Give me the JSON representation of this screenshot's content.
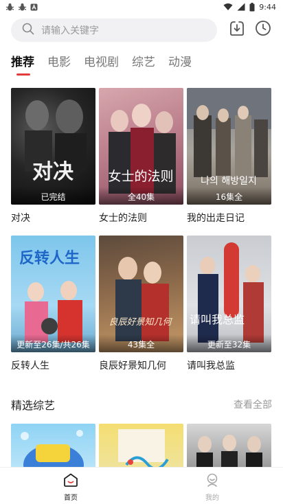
{
  "status_bar": {
    "time": "9:44",
    "left_icons": [
      "bug-icon",
      "bug-icon",
      "notification-a-icon"
    ],
    "right_icons": [
      "wifi-icon",
      "signal-icon",
      "battery-icon"
    ]
  },
  "search": {
    "placeholder": "请输入关键字"
  },
  "header_actions": {
    "download_icon": "download-icon",
    "history_icon": "clock-icon"
  },
  "tabs": [
    {
      "label": "推荐",
      "active": true
    },
    {
      "label": "电影",
      "active": false
    },
    {
      "label": "电视剧",
      "active": false
    },
    {
      "label": "综艺",
      "active": false
    },
    {
      "label": "动漫",
      "active": false
    }
  ],
  "shows_row1": [
    {
      "title": "对决",
      "badge": "已完结"
    },
    {
      "title": "女士的法则",
      "badge": "全40集"
    },
    {
      "title": "我的出走日记",
      "badge": "16集全"
    }
  ],
  "shows_row2": [
    {
      "title": "反转人生",
      "badge": "更新至26集/共26集"
    },
    {
      "title": "良辰好景知几何",
      "badge": "43集全"
    },
    {
      "title": "请叫我总监",
      "badge": "更新至32集"
    }
  ],
  "variety_section": {
    "title": "精选综艺",
    "more_label": "查看全部"
  },
  "bottom_nav": [
    {
      "label": "首页",
      "icon": "home-icon",
      "active": true
    },
    {
      "label": "我的",
      "icon": "profile-icon",
      "active": false
    }
  ],
  "colors": {
    "accent": "#e33b3b",
    "tab_inactive": "#777777",
    "placeholder": "#9a9a9a"
  }
}
